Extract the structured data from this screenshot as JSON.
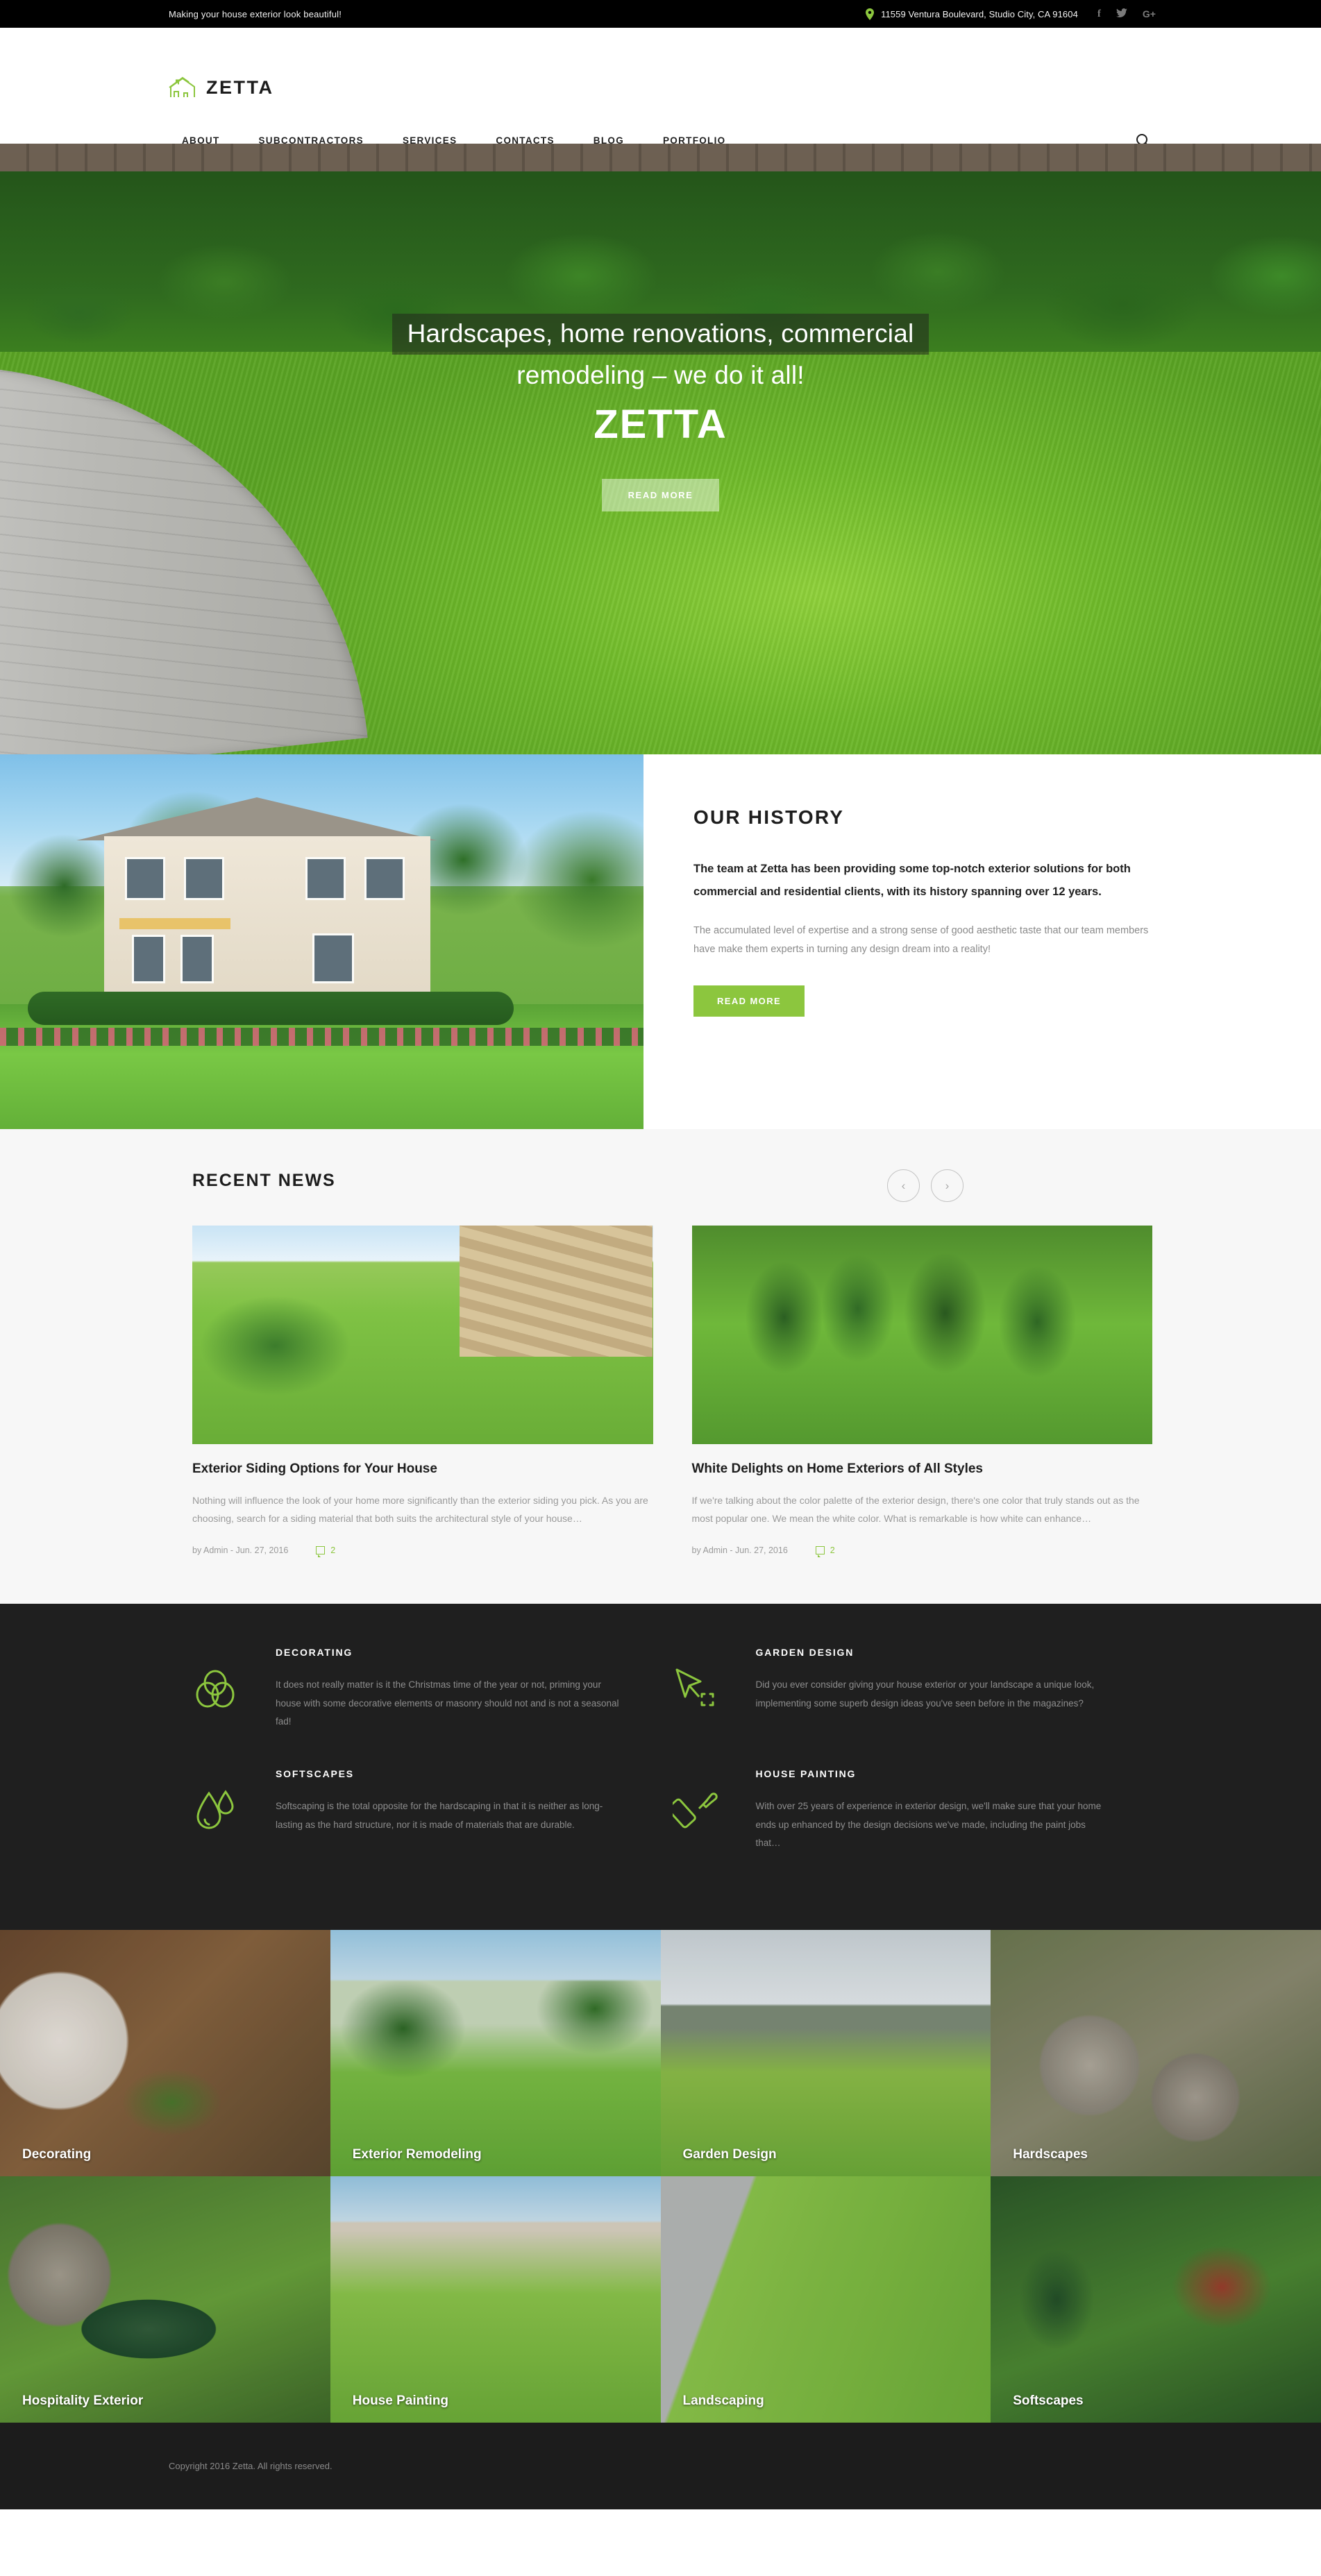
{
  "topbar": {
    "tagline": "Making your house exterior look beautiful!",
    "address": "11559 Ventura Boulevard, Studio City, CA 91604",
    "pin_icon": "location-pin-icon",
    "social": [
      {
        "name": "facebook",
        "glyph": "f"
      },
      {
        "name": "twitter",
        "glyph": "ᵛ"
      },
      {
        "name": "google-plus",
        "glyph": "G+"
      }
    ]
  },
  "header": {
    "logo_text": "ZETTA",
    "logo_icon": "house-outline-icon",
    "search_icon": "search-icon",
    "nav": [
      {
        "label": "ABOUT"
      },
      {
        "label": "SUBCONTRACTORS"
      },
      {
        "label": "SERVICES"
      },
      {
        "label": "CONTACTS"
      },
      {
        "label": "BLOG"
      },
      {
        "label": "PORTFOLIO"
      }
    ]
  },
  "hero": {
    "line1": "Hardscapes, home renovations, commercial",
    "line2": "remodeling – we do it all!",
    "brand": "ZETTA",
    "button": "READ MORE"
  },
  "history": {
    "title": "OUR HISTORY",
    "lead": "The team at Zetta has been providing some top-notch exterior solutions for both commercial and residential clients, with its history spanning over 12 years.",
    "body": "The accumulated level of expertise and a strong sense of good aesthetic taste that our team members have make them experts in turning any design dream into a reality!",
    "button": "READ MORE"
  },
  "news": {
    "title": "RECENT NEWS",
    "prev_icon": "chevron-left-icon",
    "next_icon": "chevron-right-icon",
    "posts": [
      {
        "heading": "Exterior Siding Options for Your House",
        "excerpt": "Nothing will influence the look of your home more significantly than the exterior siding you pick. As you are choosing, search for a siding material that both suits the architectural style of your house…",
        "meta": "by Admin - Jun. 27, 2016",
        "comments": "2"
      },
      {
        "heading": "White Delights on Home Exteriors of All Styles",
        "excerpt": "If we're talking about the color palette of the exterior design, there's one color that truly stands out as the most popular one. We mean the white color. What is remarkable is how white can enhance…",
        "meta": "by Admin - Jun. 27, 2016",
        "comments": "2"
      }
    ]
  },
  "services": [
    {
      "title": "DECORATING",
      "icon": "overlapping-circles-icon",
      "text": "It does not really matter is it the Christmas time of the year or not, priming your house with some decorative elements or masonry should not and is not a seasonal fad!"
    },
    {
      "title": "GARDEN DESIGN",
      "icon": "cursor-arrow-icon",
      "text": "Did you ever consider giving your house exterior or your landscape a unique look, implementing some superb design ideas you've seen before in the magazines?"
    },
    {
      "title": "SOFTSCAPES",
      "icon": "water-drops-icon",
      "text": "Softscaping is the total opposite for the hardscaping in that it is neither as long-lasting as the hard structure, nor it is made of materials that are durable."
    },
    {
      "title": "HOUSE PAINTING",
      "icon": "paint-brush-icon",
      "text": "With over 25 years of experience in exterior design, we'll make sure that your home ends up enhanced by the design decisions we've made, including the paint jobs that…"
    }
  ],
  "gallery": [
    {
      "label": "Decorating"
    },
    {
      "label": "Exterior Remodeling"
    },
    {
      "label": "Garden Design"
    },
    {
      "label": "Hardscapes"
    },
    {
      "label": "Hospitality Exterior"
    },
    {
      "label": "House Painting"
    },
    {
      "label": "Landscaping"
    },
    {
      "label": "Softscapes"
    }
  ],
  "footer": {
    "copyright": "Copyright 2016 Zetta. All rights reserved."
  },
  "colors": {
    "accent": "#8cc63e",
    "dark": "#1f1f1f",
    "topbar": "#000000",
    "news_bg": "#f7f7f7"
  }
}
